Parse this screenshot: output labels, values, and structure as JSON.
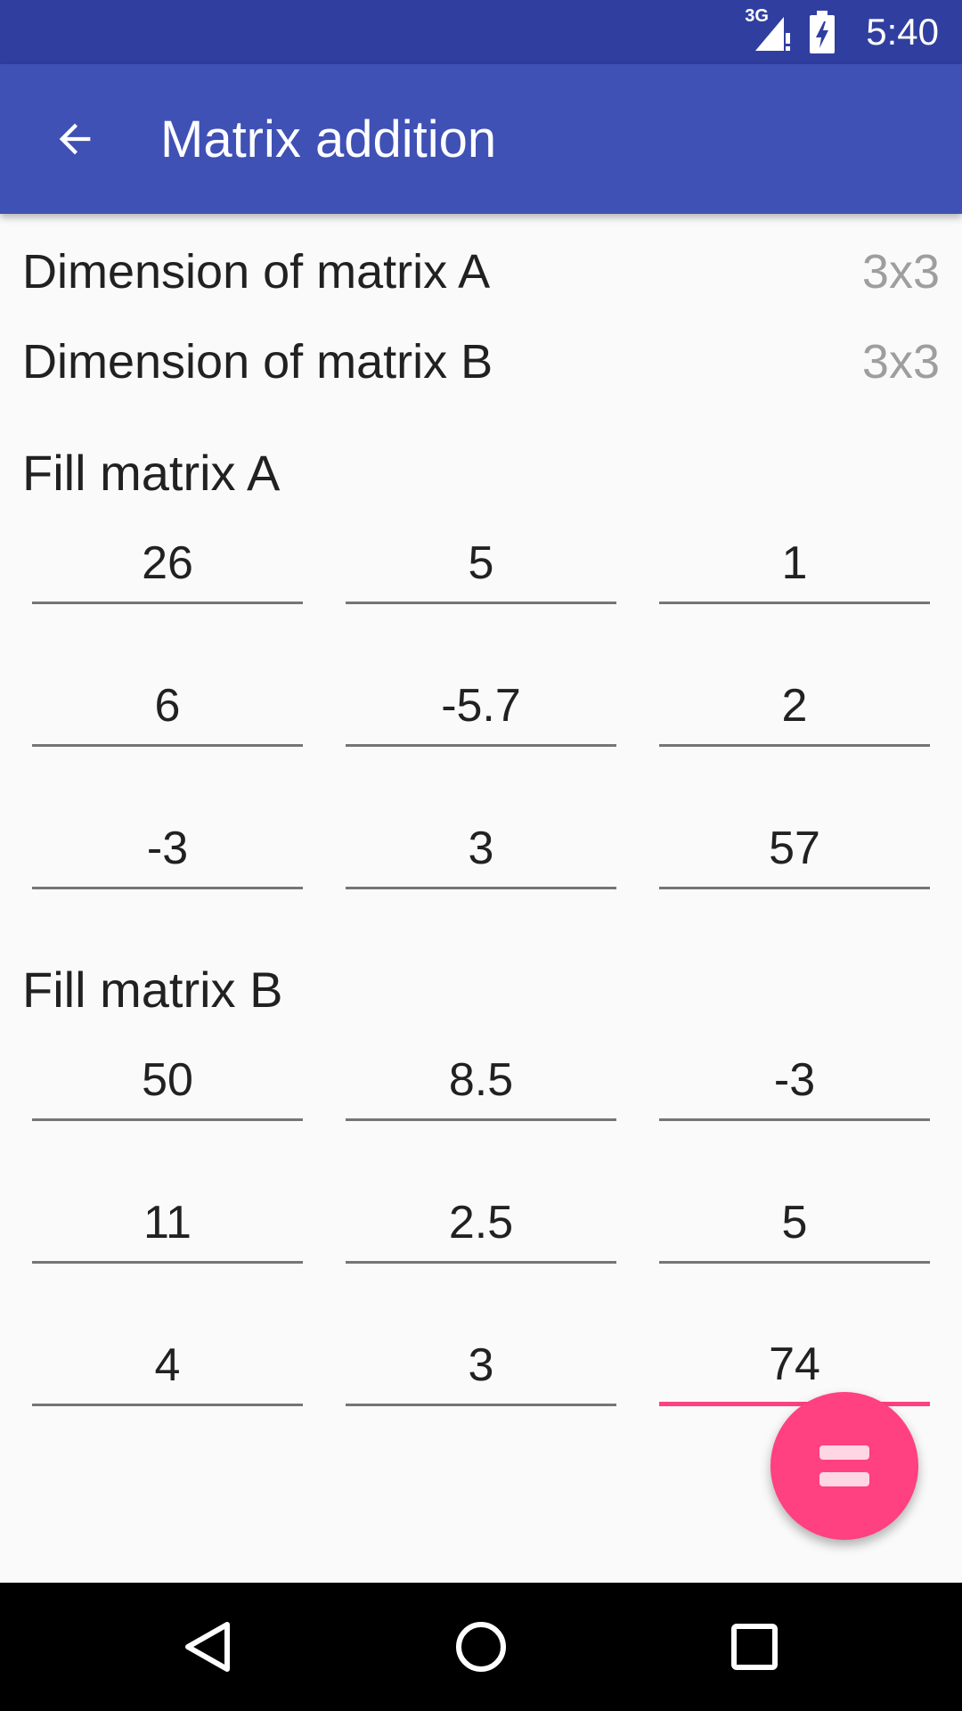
{
  "status_bar": {
    "network_label": "3G",
    "time": "5:40"
  },
  "app_bar": {
    "title": "Matrix addition",
    "back_icon": "arrow-back-icon"
  },
  "dimensions": {
    "a_label": "Dimension of matrix A",
    "a_value": "3x3",
    "b_label": "Dimension of matrix B",
    "b_value": "3x3"
  },
  "matrix_a": {
    "title": "Fill matrix A",
    "rows": [
      [
        "26",
        "5",
        "1"
      ],
      [
        "6",
        "-5.7",
        "2"
      ],
      [
        "-3",
        "3",
        "57"
      ]
    ]
  },
  "matrix_b": {
    "title": "Fill matrix B",
    "rows": [
      [
        "50",
        "8.5",
        "-3"
      ],
      [
        "11",
        "2.5",
        "5"
      ],
      [
        "4",
        "3",
        "74"
      ]
    ]
  },
  "fab": {
    "icon": "equals-icon"
  },
  "nav": {
    "back_icon": "nav-back-icon",
    "home_icon": "nav-home-icon",
    "recents_icon": "nav-recents-icon"
  },
  "colors": {
    "status_bar": "#303f9f",
    "app_bar": "#3f51b5",
    "accent": "#ff4081"
  }
}
